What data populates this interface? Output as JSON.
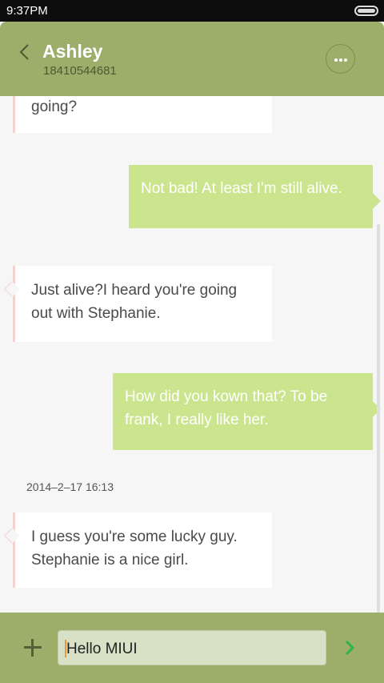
{
  "status_bar": {
    "time": "9:37PM",
    "battery_icon": "battery-icon"
  },
  "header": {
    "back_icon": "chevron-left-icon",
    "contact_name": "Ashley",
    "contact_number": "18410544681",
    "more_icon": "more-dots-icon"
  },
  "messages": [
    {
      "direction": "incoming",
      "text": "going?"
    },
    {
      "direction": "outgoing",
      "text": "Not bad! At least I'm still alive."
    },
    {
      "direction": "incoming",
      "line1": "Just  alive?I heard you're going",
      "line2": "out with Stephanie."
    },
    {
      "direction": "outgoing",
      "line1": "How did you kown that? To be",
      "line2": "frank, I really like her."
    },
    {
      "direction": "incoming",
      "line1": "I guess you're some lucky guy.",
      "line2": "Stephanie is a nice girl."
    }
  ],
  "timestamp": "2014–2–17 16:13",
  "composer": {
    "add_icon": "plus-icon",
    "input_value": "Hello MIUI",
    "send_icon": "chevron-right-icon"
  },
  "colors": {
    "header": "#9dad6a",
    "outgoing_bubble": "#cbe58f",
    "incoming_bubble": "#ffffff",
    "send_accent": "#2fb544"
  }
}
